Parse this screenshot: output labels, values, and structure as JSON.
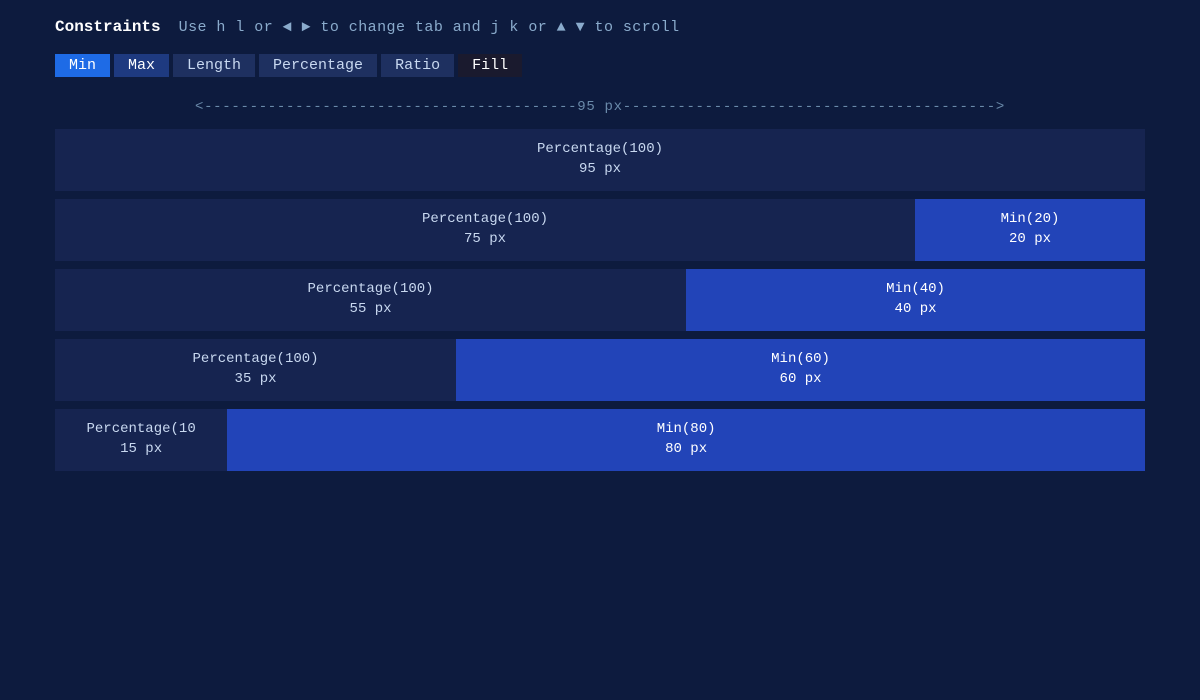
{
  "header": {
    "title": "Constraints",
    "hint": "Use h l or ◄ ► to change tab and j k or ▲ ▼ to scroll"
  },
  "tabs": [
    {
      "label": "Min",
      "state": "active-min"
    },
    {
      "label": "Max",
      "state": "active-max"
    },
    {
      "label": "Length",
      "state": ""
    },
    {
      "label": "Percentage",
      "state": ""
    },
    {
      "label": "Ratio",
      "state": ""
    },
    {
      "label": "Fill",
      "state": "fill"
    }
  ],
  "ruler": "<-----------------------------------------95 px----------------------------------------->",
  "bars": [
    {
      "percentage_label": "Percentage(100)",
      "percentage_px": "95 px",
      "percentage_width": 100,
      "min_label": "",
      "min_px": "",
      "min_width": 0
    },
    {
      "percentage_label": "Percentage(100)",
      "percentage_px": "75 px",
      "percentage_width": 78.9,
      "min_label": "Min(20)",
      "min_px": "20 px",
      "min_width": 21.1
    },
    {
      "percentage_label": "Percentage(100)",
      "percentage_px": "55 px",
      "percentage_width": 57.9,
      "min_label": "Min(40)",
      "min_px": "40 px",
      "min_width": 42.1
    },
    {
      "percentage_label": "Percentage(100)",
      "percentage_px": "35 px",
      "percentage_width": 36.8,
      "min_label": "Min(60)",
      "min_px": "60 px",
      "min_width": 63.2
    },
    {
      "percentage_label": "Percentage(10",
      "percentage_px": "15 px",
      "percentage_width": 15.8,
      "min_label": "Min(80)",
      "min_px": "80 px",
      "min_width": 84.2
    }
  ],
  "fill_tab_bg": "#1a1a2e"
}
